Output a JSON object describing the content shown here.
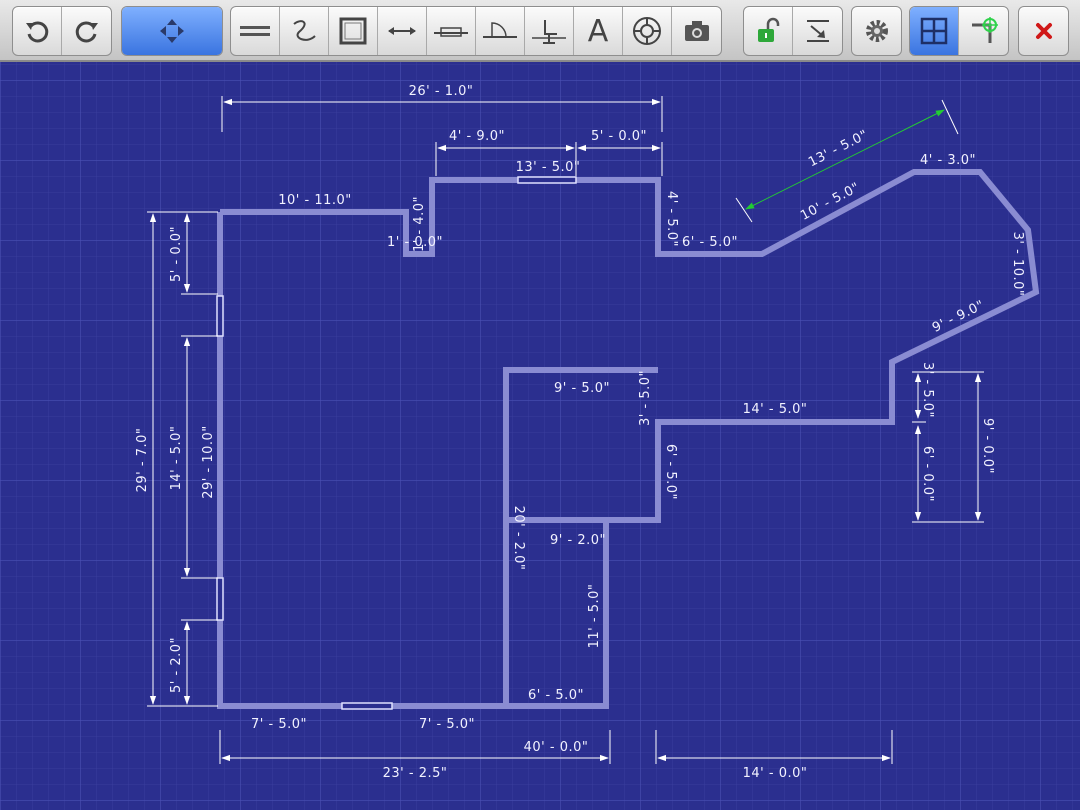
{
  "toolbar": {
    "buttons": [
      {
        "name": "undo",
        "active": false
      },
      {
        "name": "redo",
        "active": false
      },
      {
        "name": "select-move",
        "active": true
      },
      {
        "name": "wall",
        "active": false
      },
      {
        "name": "freehand",
        "active": false
      },
      {
        "name": "room",
        "active": false
      },
      {
        "name": "dimension",
        "active": false
      },
      {
        "name": "window",
        "active": false
      },
      {
        "name": "door",
        "active": false
      },
      {
        "name": "furniture",
        "active": false
      },
      {
        "name": "text",
        "active": false
      },
      {
        "name": "symbol",
        "active": false
      },
      {
        "name": "camera",
        "active": false
      },
      {
        "name": "lock",
        "active": false
      },
      {
        "name": "import",
        "active": false
      },
      {
        "name": "settings",
        "active": false
      },
      {
        "name": "grid",
        "active": true
      },
      {
        "name": "snap",
        "active": false
      },
      {
        "name": "close",
        "active": false
      }
    ],
    "text_tool_label": "A"
  },
  "colors": {
    "background": "#2b2f8f",
    "grid": "#4146a6",
    "wall": "#8a8cd2",
    "selected_dimension": "#22cc33"
  },
  "dimensions": {
    "top_overall": "26' - 1.0\"",
    "top_notch_left": "4' - 9.0\"",
    "top_notch_right": "5' - 0.0\"",
    "top_wall": "13' - 5.0\"",
    "left_top_wall": "10' - 11.0\"",
    "notch_depth": "1' - 0.0\"",
    "notch_width": "1' - 4.0\"",
    "right_top_drop": "4' - 5.0\"",
    "right_top_run": "6' - 5.0\"",
    "diagonal_selected": "13' - 5.0\"",
    "diagonal_wall": "10' - 5.0\"",
    "top_right_wall": "4' - 3.0\"",
    "right_slant": "3' - 10.0\"",
    "lower_diagonal": "9' - 9.0\"",
    "mid_notch_drop": "3' - 5.0\"",
    "mid_notch_lower": "6' - 0.0\"",
    "right_total": "9' - 0.0\"",
    "inner_horizontal": "14' - 5.0\"",
    "inner_room_top": "9' - 5.0\"",
    "inner_room_drop": "3' - 5.0\"",
    "inner_room_right": "6' - 5.0\"",
    "inner_room_bottom": "9' - 2.0\"",
    "inner_left_long": "20' - 2.0\"",
    "inner_right_long": "11' - 5.0\"",
    "bottom_inner": "6' - 5.0\"",
    "left_outer": "29' - 7.0\"",
    "left_inner": "29' - 10.0\"",
    "left_top_seg": "5' - 0.0\"",
    "left_mid_seg": "14' - 5.0\"",
    "left_bottom_seg": "5' - 2.0\"",
    "bottom_left_seg": "7' - 5.0\"",
    "bottom_mid_seg": "7' - 5.0\"",
    "bottom_total": "40' - 0.0\"",
    "bottom_left_total": "23' - 2.5\"",
    "bottom_right_total": "14' - 0.0\""
  }
}
